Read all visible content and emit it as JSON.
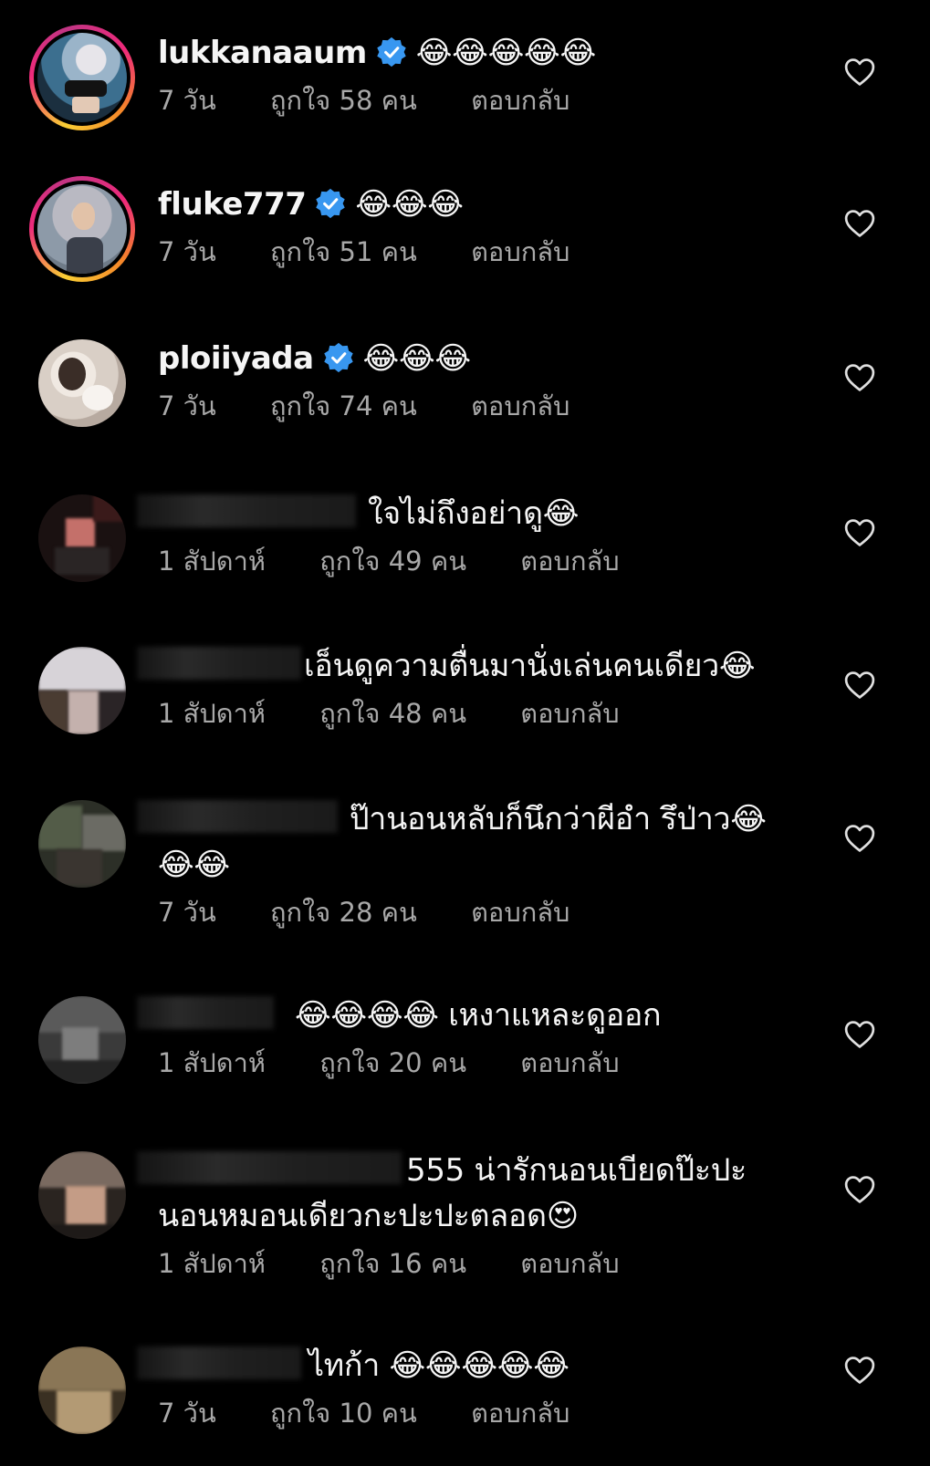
{
  "colors": {
    "background": "#000000",
    "meta_text": "#a8a8a8",
    "verified_blue": "#3897f0"
  },
  "comments": [
    {
      "username": "lukkanaaum",
      "verified": true,
      "text": "😂😂😂😂😂",
      "time": "7 วัน",
      "likes": "ถูกใจ 58 คน",
      "reply": "ตอบกลับ",
      "heart_icon": "heart-outline"
    },
    {
      "username": "fluke777",
      "verified": true,
      "text": "😂😂😂",
      "time": "7 วัน",
      "likes": "ถูกใจ 51 คน",
      "reply": "ตอบกลับ",
      "heart_icon": "heart-outline"
    },
    {
      "username": "ploiiyada",
      "verified": true,
      "text": "😂😂😂",
      "time": "7 วัน",
      "likes": "ถูกใจ 74 คน",
      "reply": "ตอบกลับ",
      "heart_icon": "heart-outline"
    },
    {
      "username": "",
      "verified": false,
      "text": "ใจไม่ถึงอย่าดู😂",
      "time": "1 สัปดาห์",
      "likes": "ถูกใจ 49 คน",
      "reply": "ตอบกลับ",
      "heart_icon": "heart-outline"
    },
    {
      "username": "",
      "verified": false,
      "text": "เอ็นดูความตื่นมานั่งเล่นคนเดียว😂",
      "time": "1 สัปดาห์",
      "likes": "ถูกใจ 48 คน",
      "reply": "ตอบกลับ",
      "heart_icon": "heart-outline"
    },
    {
      "username": "",
      "verified": false,
      "text": "ป๊านอนหลับก็นึกว่าผีอำ รึป่าว😂",
      "text2": "😂😂",
      "time": "7 วัน",
      "likes": "ถูกใจ 28 คน",
      "reply": "ตอบกลับ",
      "heart_icon": "heart-outline"
    },
    {
      "username": "",
      "verified": false,
      "text": "😂😂😂😂 เหงาแหละดูออก",
      "time": "1 สัปดาห์",
      "likes": "ถูกใจ 20 คน",
      "reply": "ตอบกลับ",
      "heart_icon": "heart-outline"
    },
    {
      "username": "",
      "verified": false,
      "text": "555 น่ารักนอนเบียดป๊ะปะ",
      "text2": "นอนหมอนเดียวกะปะปะตลอด😍",
      "time": "1 สัปดาห์",
      "likes": "ถูกใจ 16 คน",
      "reply": "ตอบกลับ",
      "heart_icon": "heart-outline"
    },
    {
      "username": "",
      "verified": false,
      "text": "ไทก้า 😂😂😂😂😂",
      "time": "7 วัน",
      "likes": "ถูกใจ 10 คน",
      "reply": "ตอบกลับ",
      "heart_icon": "heart-outline"
    }
  ]
}
